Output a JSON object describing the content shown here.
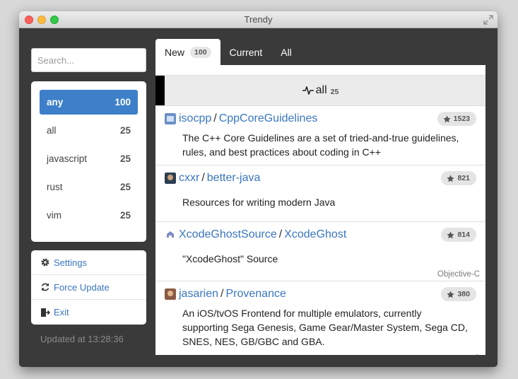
{
  "window": {
    "title": "Trendy"
  },
  "sidebar": {
    "search_placeholder": "Search...",
    "languages": [
      {
        "label": "any",
        "count": "100",
        "active": true
      },
      {
        "label": "all",
        "count": "25"
      },
      {
        "label": "javascript",
        "count": "25"
      },
      {
        "label": "rust",
        "count": "25"
      },
      {
        "label": "vim",
        "count": "25"
      }
    ],
    "actions": {
      "settings": "Settings",
      "force_update": "Force Update",
      "exit": "Exit"
    },
    "updated": "Updated at 13:28:36"
  },
  "tabs": {
    "new_label": "New",
    "new_count": "100",
    "current_label": "Current",
    "all_label": "All"
  },
  "group": {
    "label": "all",
    "count": "25"
  },
  "repos": [
    {
      "owner": "isocpp",
      "name": "CppCoreGuidelines",
      "stars": "1523",
      "description": "The C++ Core Guidelines are a set of tried-and-true guidelines, rules, and best practices about coding in C++",
      "language": ""
    },
    {
      "owner": "cxxr",
      "name": "better-java",
      "stars": "821",
      "description": "Resources for writing modern Java",
      "language": ""
    },
    {
      "owner": "XcodeGhostSource",
      "name": "XcodeGhost",
      "stars": "814",
      "description": "\"XcodeGhost\" Source",
      "language": "Objective-C"
    },
    {
      "owner": "jasarien",
      "name": "Provenance",
      "stars": "380",
      "description": "An iOS/tvOS Frontend for multiple emulators, currently supporting Sega Genesis, Game Gear/Master System, Sega CD, SNES, NES, GB/GBC and GBA.",
      "language": "C"
    }
  ],
  "colors": {
    "accent": "#3e7fca",
    "link": "#3a76be",
    "window_bg": "#3a3a3a"
  }
}
